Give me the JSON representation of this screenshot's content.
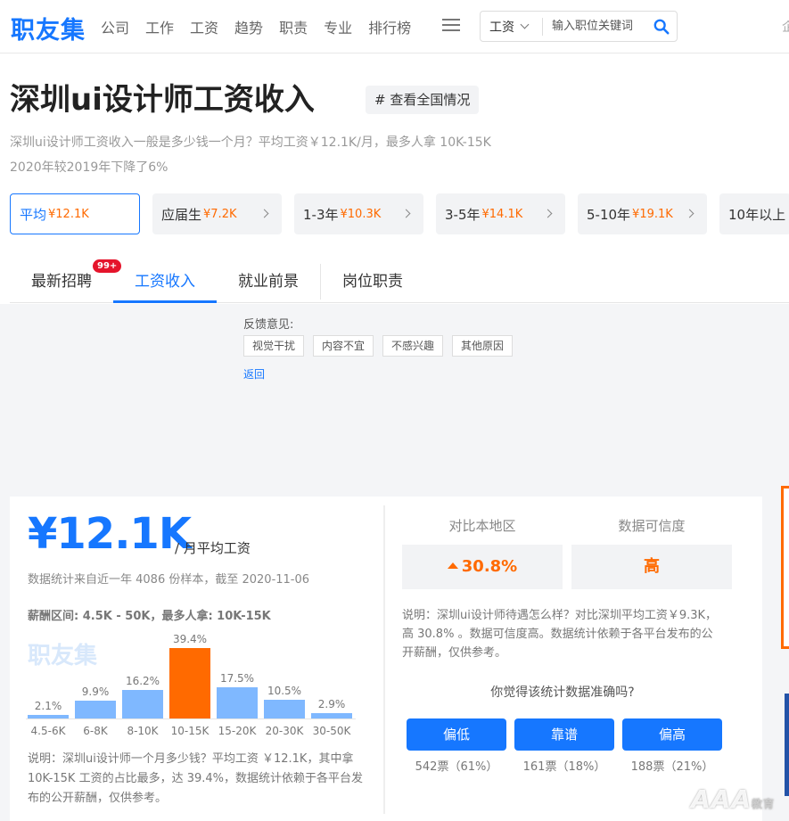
{
  "header": {
    "logo": "职友集",
    "nav": [
      "公司",
      "工作",
      "工资",
      "趋势",
      "职责",
      "专业",
      "排行榜"
    ],
    "search_select": "工资",
    "search_placeholder": "输入职位关键词",
    "edge_char": "企"
  },
  "title": {
    "main": "深圳ui设计师工资收入",
    "tag": "# 查看全国情况",
    "desc_line1": "深圳ui设计师工资收入一般是多少钱一个月？平均工资￥12.1K/月，最多人拿 10K-15K",
    "desc_line2": "2020年较2019年下降了6%"
  },
  "experience": [
    {
      "label": "平均",
      "salary": "¥12.1K",
      "active": true
    },
    {
      "label": "应届生",
      "salary": "¥7.2K"
    },
    {
      "label": "1-3年",
      "salary": "¥10.3K"
    },
    {
      "label": "3-5年",
      "salary": "¥14.1K"
    },
    {
      "label": "5-10年",
      "salary": "¥19.1K"
    },
    {
      "label": "10年以上",
      "salary": ""
    }
  ],
  "tabs": {
    "items": [
      "最新招聘",
      "工资收入",
      "就业前景",
      "岗位职责"
    ],
    "badge": "99+"
  },
  "feedback": {
    "title": "反馈意见:",
    "options": [
      "视觉干扰",
      "内容不宜",
      "不感兴趣",
      "其他原因"
    ],
    "back": "返回"
  },
  "summary": {
    "salary": "¥12.1K",
    "unit": "/ 月平均工资",
    "sample_note": "数据统计来自近一年 4086 份样本，截至 2020-11-06",
    "range_note": "薪酬区间: 4.5K - 50K，最多人拿: 10K-15K",
    "watermark": "职友集",
    "chart_desc": "说明：深圳ui设计师一个月多少钱？平均工资 ￥12.1K，其中拿 10K-15K 工资的占比最多，达 39.4%，数据统计依赖于各平台发布的公开薪酬，仅供参考。"
  },
  "chart_data": {
    "type": "bar",
    "categories": [
      "4.5-6K",
      "6-8K",
      "8-10K",
      "10-15K",
      "15-20K",
      "20-30K",
      "30-50K"
    ],
    "values": [
      2.1,
      9.9,
      16.2,
      39.4,
      17.5,
      10.5,
      2.9
    ],
    "value_labels": [
      "2.1%",
      "9.9%",
      "16.2%",
      "39.4%",
      "17.5%",
      "10.5%",
      "2.9%"
    ],
    "highlight_index": 3,
    "colors": {
      "normal": "#7fb8ff",
      "highlight": "#ff6a00"
    },
    "ylim": [
      0,
      40
    ]
  },
  "compare": {
    "local_label": "对比本地区",
    "local_value": "30.8%",
    "credibility_label": "数据可信度",
    "credibility_value": "高",
    "desc": "说明：深圳ui设计师待遇怎么样？对比深圳平均工资￥9.3K，高 30.8% 。数据可信度高。数据统计依赖于各平台发布的公开薪酬，仅供参考。",
    "vote_question": "你觉得该统计数据准确吗?",
    "votes": [
      {
        "label": "偏低",
        "count": "542票（61%）"
      },
      {
        "label": "靠谱",
        "count": "161票（18%）"
      },
      {
        "label": "偏高",
        "count": "188票（21%）"
      }
    ]
  },
  "corner_watermark": {
    "text": "AAA",
    "sub": "教育"
  },
  "colors": {
    "brand": "#1677ff",
    "accent": "#ff6a00"
  }
}
